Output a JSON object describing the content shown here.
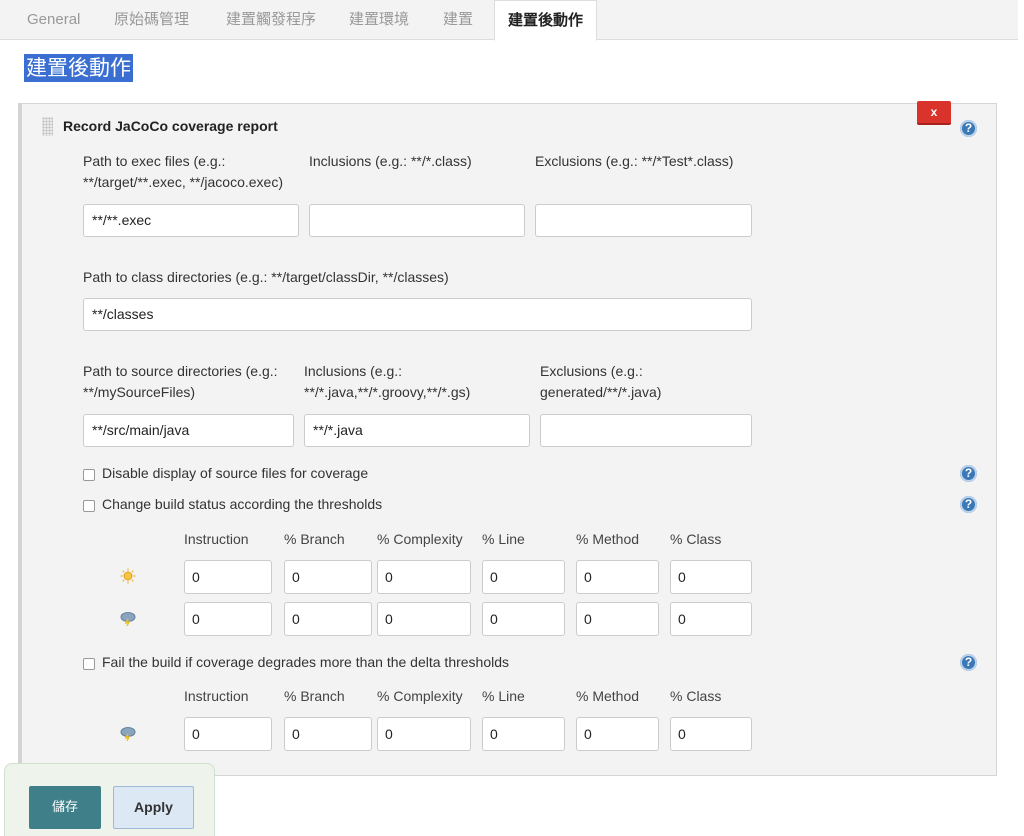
{
  "tabs": [
    {
      "label": "General"
    },
    {
      "label": "原始碼管理"
    },
    {
      "label": "建置觸發程序"
    },
    {
      "label": "建置環境"
    },
    {
      "label": "建置"
    },
    {
      "label": "建置後動作"
    }
  ],
  "section_title": "建置後動作",
  "panel": {
    "title": "Record JaCoCo coverage report",
    "delete_label": "x",
    "help": "?"
  },
  "exec": {
    "path_label_line1": "Path to exec files (e.g.:",
    "path_label_line2": "**/target/**.exec, **/jacoco.exec)",
    "path_value": "**/**.exec",
    "inclusions_label": "Inclusions (e.g.: **/*.class)",
    "inclusions_value": "",
    "exclusions_label": "Exclusions (e.g.: **/*Test*.class)",
    "exclusions_value": ""
  },
  "classdirs": {
    "label": "Path to class directories (e.g.: **/target/classDir, **/classes)",
    "value": "**/classes"
  },
  "source": {
    "path_label_line1": "Path to source directories (e.g.:",
    "path_label_line2": "**/mySourceFiles)",
    "path_value": "**/src/main/java",
    "inclusions_label_line1": "Inclusions (e.g.:",
    "inclusions_label_line2": "**/*.java,**/*.groovy,**/*.gs)",
    "inclusions_value": "**/*.java",
    "exclusions_label_line1": "Exclusions (e.g.:",
    "exclusions_label_line2": "generated/**/*.java)",
    "exclusions_value": ""
  },
  "options": {
    "disable_source": "Disable display of source files for coverage",
    "change_status": "Change build status according the thresholds",
    "fail_delta": "Fail the build if coverage degrades more than the delta thresholds"
  },
  "columns": [
    "Instruction",
    "% Branch",
    "% Complexity",
    "% Line",
    "% Method",
    "% Class"
  ],
  "thresholds": {
    "sunny": [
      "0",
      "0",
      "0",
      "0",
      "0",
      "0"
    ],
    "stormy": [
      "0",
      "0",
      "0",
      "0",
      "0",
      "0"
    ]
  },
  "delta": {
    "stormy": [
      "0",
      "0",
      "0",
      "0",
      "0",
      "0"
    ]
  },
  "footer": {
    "save_label": "儲存",
    "apply_label": "Apply"
  },
  "colors": {
    "section_highlight": "#3a6fd1",
    "delete": "#d9332b",
    "help": "#3a78b8",
    "save": "#3e7f8a",
    "apply": "#dde8f5"
  },
  "icons": {
    "sunny": "sunny-weather-icon",
    "stormy": "stormy-weather-icon",
    "grip": "drag-handle-icon"
  }
}
